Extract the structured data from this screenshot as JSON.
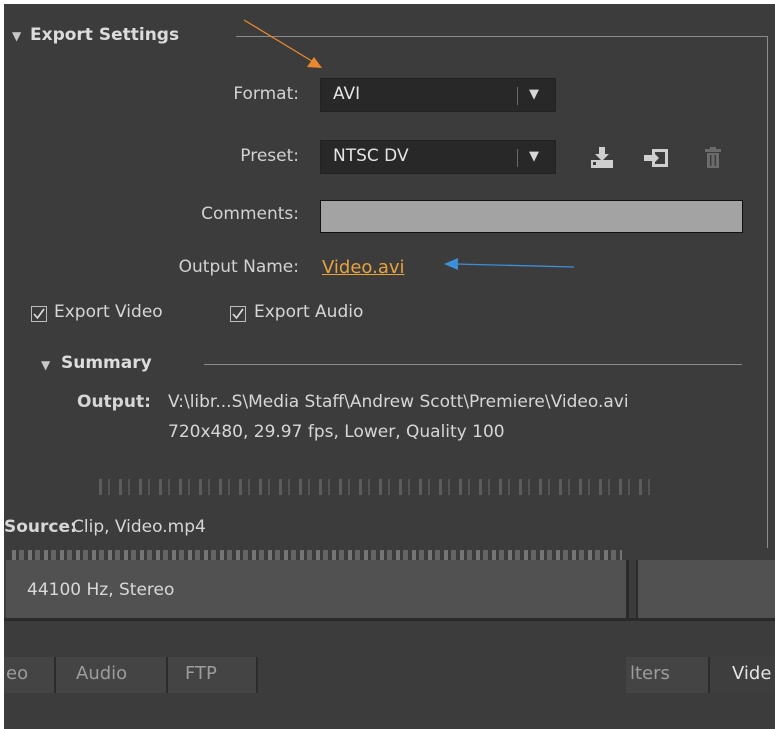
{
  "export_settings": {
    "title": "Export Settings",
    "format_label": "Format:",
    "format_value": "AVI",
    "preset_label": "Preset:",
    "preset_value": "NTSC DV",
    "comments_label": "Comments:",
    "comments_value": "",
    "output_name_label": "Output Name:",
    "output_name_value": "Video.avi",
    "export_video_label": "Export Video",
    "export_video_checked": true,
    "export_audio_label": "Export Audio",
    "export_audio_checked": true
  },
  "summary": {
    "title": "Summary",
    "output_label": "Output:",
    "output_path": "V:\\libr...S\\Media Staff\\Andrew Scott\\Premiere\\Video.avi",
    "output_details": "720x480, 29.97 fps, Lower, Quality 100",
    "source_label": "Source:",
    "source_value": "Clip, Video.mp4"
  },
  "audio_info": "44100 Hz, Stereo",
  "tabs": [
    {
      "label": "eo"
    },
    {
      "label": "Audio"
    },
    {
      "label": "FTP"
    },
    {
      "label": "lters"
    },
    {
      "label": "Vide"
    }
  ],
  "icons": {
    "dropdown": "triangle-down",
    "save_preset": "save-preset-icon",
    "import_preset": "import-preset-icon",
    "delete_preset": "trash-icon"
  },
  "colors": {
    "background": "#3c3c3c",
    "link": "#e8a33d",
    "arrow_orange": "#e8872e",
    "arrow_blue": "#3d8fd8"
  }
}
